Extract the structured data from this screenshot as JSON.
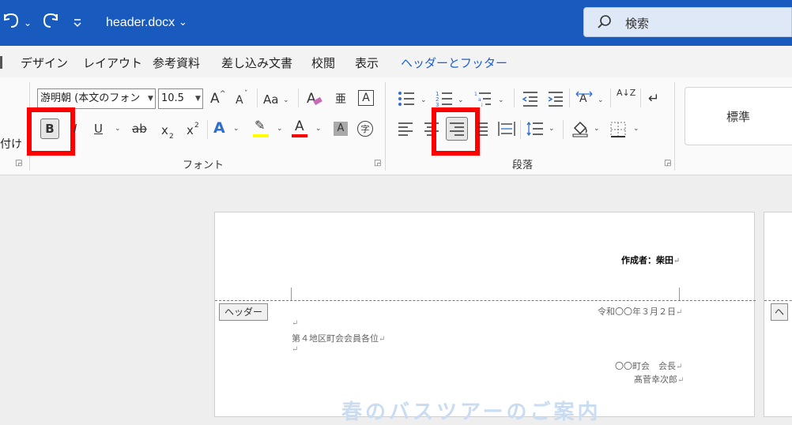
{
  "title_bar": {
    "undo_icon": "undo-icon",
    "undo_caret": "⌄",
    "redo_icon": "redo-icon",
    "customize_icon": "customize-qat-icon",
    "document_title": "header.docx",
    "title_caret": "⌄",
    "search_label": "検索",
    "colors": {
      "background": "#185abd",
      "search_bg": "#dfe8f6"
    }
  },
  "tabs": [
    "デザイン",
    "レイアウト",
    "参考資料",
    "差し込み文書",
    "校閲",
    "表示",
    "ヘッダーとフッター"
  ],
  "active_context_tab_color": "#1d5fcf",
  "ribbon": {
    "left_cut_label": "付け",
    "font_group": {
      "label": "フォント",
      "font_name": "游明朝 (本文のフォン",
      "font_size": "10.5",
      "grow": "A",
      "shrink": "A",
      "case": "Aa",
      "clear_format": "A",
      "phonetic": "亜",
      "char_border": "A",
      "bold": "B",
      "italic": "I",
      "underline": "U",
      "strike": "ab",
      "subscript": "x",
      "sub_mark": "2",
      "superscript": "x",
      "super_mark": "2",
      "text_effect": "A",
      "highlight": "✎",
      "font_color": "A",
      "char_shading": "A",
      "enclose": "字"
    },
    "paragraph_group": {
      "label": "段落",
      "sort": "A↓Z",
      "show_marks": "↵"
    },
    "style_preview": "標準",
    "highlight_color": "#ffff00",
    "font_color_bar": "#ff0000",
    "callout_color": "#ff0000"
  },
  "document": {
    "author_line": "作成者：柴田",
    "header_tag": "ヘッダー",
    "date_line": "令和〇〇年３月２日",
    "empty_para": "↵",
    "recipient": "第４地区町会会員各位",
    "sender_org": "〇〇町会　会長",
    "sender_name": "髙菅幸次郎",
    "watermark_title": "春のバスツアーのご案内",
    "page2_tag": "ヘ"
  }
}
